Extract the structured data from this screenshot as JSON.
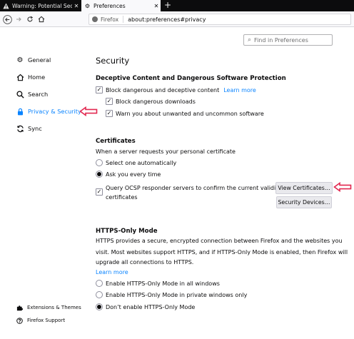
{
  "tabs": [
    {
      "label": "Warning: Potential Secu",
      "icon": "warning-icon"
    },
    {
      "label": "Preferences",
      "icon": "gear-icon"
    }
  ],
  "toolbar": {
    "brand": "Firefox",
    "url": "about:preferences#privacy"
  },
  "search": {
    "placeholder": "Find in Preferences"
  },
  "sidebar": {
    "items": [
      {
        "label": "General",
        "icon": "gear-icon"
      },
      {
        "label": "Home",
        "icon": "home-icon"
      },
      {
        "label": "Search",
        "icon": "search-icon"
      },
      {
        "label": "Privacy & Security",
        "icon": "lock-icon",
        "active": true
      },
      {
        "label": "Sync",
        "icon": "sync-icon"
      }
    ],
    "footer": [
      {
        "label": "Extensions & Themes",
        "icon": "puzzle-icon"
      },
      {
        "label": "Firefox Support",
        "icon": "help-icon"
      }
    ]
  },
  "main": {
    "title": "Security",
    "deceptive": {
      "heading": "Deceptive Content and Dangerous Software Protection",
      "block_dangerous": "Block dangerous and deceptive content",
      "learn_more": "Learn more",
      "block_downloads": "Block dangerous downloads",
      "warn_unwanted": "Warn you about unwanted and uncommon software"
    },
    "certificates": {
      "heading": "Certificates",
      "description": "When a server requests your personal certificate",
      "select_auto": "Select one automatically",
      "ask_every": "Ask you every time",
      "ocsp_line1": "Query OCSP responder servers to confirm the current validity of",
      "ocsp_line2": "certificates",
      "view_button": "View Certificates…",
      "devices_button": "Security Devices…"
    },
    "https": {
      "heading": "HTTPS-Only Mode",
      "desc1": "HTTPS provides a secure, encrypted connection between Firefox and the websites you",
      "desc2": "visit. Most websites support HTTPS, and if HTTPS-Only Mode is enabled, then Firefox will",
      "desc3": "upgrade all connections to HTTPS.",
      "learn_more": "Learn more",
      "opt_all": "Enable HTTPS-Only Mode in all windows",
      "opt_private": "Enable HTTPS-Only Mode in private windows only",
      "opt_none": "Don’t enable HTTPS-Only Mode"
    }
  },
  "colors": {
    "accent": "#0a84ff",
    "annotation": "#e22850"
  }
}
